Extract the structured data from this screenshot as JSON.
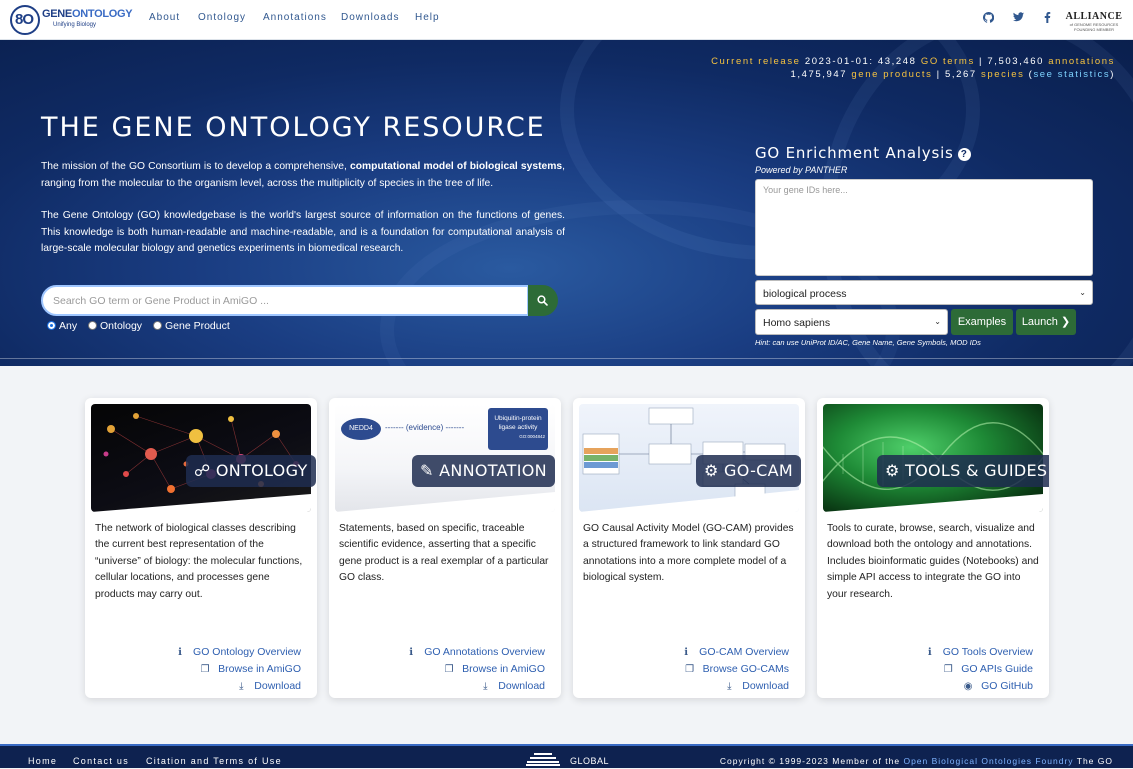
{
  "brand": {
    "name_prefix": "GENE",
    "name_suffix": "ONTOLOGY",
    "tagline": "Unifying Biology",
    "mark": "8O"
  },
  "nav": {
    "items": [
      "About",
      "Ontology",
      "Annotations",
      "Downloads",
      "Help"
    ]
  },
  "social": {
    "github": "github-icon",
    "twitter": "twitter-icon",
    "facebook": "facebook-icon"
  },
  "alliance": {
    "title": "ALLIANCE",
    "sub1": "of GENOME RESOURCES",
    "sub2": "FOUNDING MEMBER"
  },
  "release": {
    "label": "Current release",
    "date": "2023-01-01",
    "go_terms_count": "43,248",
    "go_terms_label": "GO terms",
    "annotations_count": "7,503,460",
    "annotations_label": "annotations",
    "gene_products_count": "1,475,947",
    "gene_products_label": "gene products",
    "species_count": "5,267",
    "species_label": "species",
    "stats_link": "see statistics"
  },
  "hero": {
    "title": "THE GENE ONTOLOGY RESOURCE",
    "p1_pre": "The mission of the GO Consortium is to develop a comprehensive, ",
    "p1_bold": "computational model of biological systems",
    "p1_post": ", ranging from the molecular to the organism level, across the multiplicity of species in the tree of life.",
    "p2": "The Gene Ontology (GO) knowledgebase is the world's largest source of information on the functions of genes. This knowledge is both human-readable and machine-readable, and is a foundation for computational analysis of large-scale molecular biology and genetics experiments in biomedical research."
  },
  "search": {
    "placeholder": "Search GO term or Gene Product in AmiGO ...",
    "options": [
      "Any",
      "Ontology",
      "Gene Product"
    ],
    "selected": "Any"
  },
  "enrichment": {
    "title": "GO Enrichment Analysis",
    "powered": "Powered by PANTHER",
    "placeholder": "Your gene IDs here...",
    "aspect": "biological process",
    "organism": "Homo sapiens",
    "examples_label": "Examples",
    "launch_label": "Launch",
    "hint": "Hint: can use UniProt ID/AC, Gene Name, Gene Symbols, MOD IDs"
  },
  "cards": [
    {
      "badge": "ONTOLOGY",
      "text": "The network of biological classes describing the current best representation of the “universe” of biology: the molecular functions, cellular locations, and processes gene products may carry out.",
      "links": [
        "GO Ontology Overview",
        "Browse in AmiGO",
        "Download"
      ]
    },
    {
      "badge": "ANNOTATION",
      "text": "Statements, based on specific, traceable scientific evidence, asserting that a specific gene product is a real exemplar of a particular GO class.",
      "links": [
        "GO Annotations Overview",
        "Browse in AmiGO",
        "Download"
      ],
      "diagram": {
        "node": "NEDD4",
        "edge": "(evidence)",
        "target": "Ubiquitin-protein ligase activity",
        "target_id": "GO:0004842"
      }
    },
    {
      "badge": "GO-CAM",
      "text": "GO Causal Activity Model (GO-CAM) provides a structured framework to link standard GO annotations into a more complete model of a biological system.",
      "links": [
        "GO-CAM Overview",
        "Browse GO-CAMs",
        "Download"
      ]
    },
    {
      "badge": "TOOLS & GUIDES",
      "text": "Tools to curate, browse, search, visualize and download both the ontology and annotations. Includes bioinformatic guides (Notebooks) and simple API access to integrate the GO into your research.",
      "links": [
        "GO Tools Overview",
        "GO APIs Guide",
        "GO GitHub"
      ]
    }
  ],
  "footer": {
    "links": [
      "Home",
      "Contact us",
      "Citation and Terms of Use"
    ],
    "global_label": "GLOBAL",
    "copyright_pre": "Copyright © 1999-2023 Member of the",
    "obo_link": "Open Biological Ontologies Foundry",
    "copyright_post": "The GO"
  },
  "colors": {
    "navy": "#0f2a63",
    "accent_gold": "#f5c240",
    "accent_cyan": "#7fd3ff",
    "button_green": "#2d6b37",
    "link_blue": "#2e5fb0"
  }
}
